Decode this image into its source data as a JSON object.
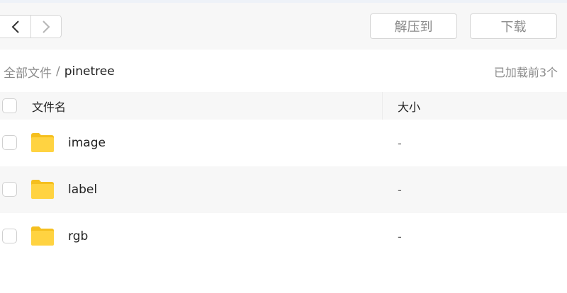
{
  "toolbar": {
    "back_icon": "chevron-left-icon",
    "forward_icon": "chevron-right-icon",
    "extract_label": "解压到",
    "download_label": "下载"
  },
  "breadcrumb": {
    "root": "全部文件",
    "separator": "/",
    "current": "pinetree"
  },
  "loaded_note": "已加载前3个",
  "table": {
    "col_name": "文件名",
    "col_size": "大小",
    "rows": [
      {
        "name": "image",
        "size": "-",
        "icon": "folder-icon"
      },
      {
        "name": "label",
        "size": "-",
        "icon": "folder-icon"
      },
      {
        "name": "rgb",
        "size": "-",
        "icon": "folder-icon"
      }
    ]
  },
  "colors": {
    "folder": "#ffd341",
    "folder_tab": "#f5bf1e",
    "muted_text": "#8a8a8a",
    "header_bg": "#f7f7f7"
  }
}
